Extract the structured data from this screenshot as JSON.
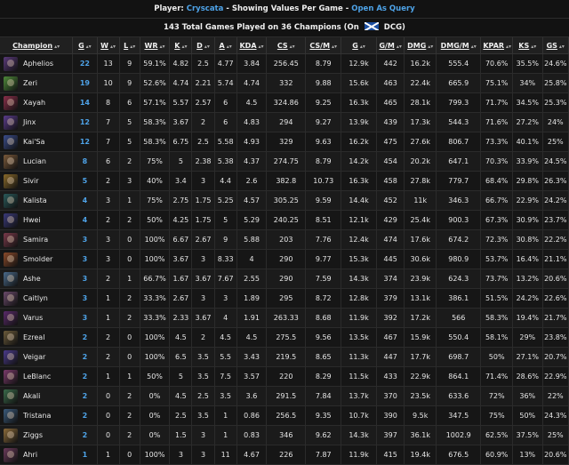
{
  "header": {
    "player_label": "Player:",
    "player_name": "Cryscata",
    "dash1": "-",
    "mode_text": "Showing Values Per Game",
    "dash2": "-",
    "query_link": "Open As Query"
  },
  "subheader": {
    "summary": "143 Total Games Played on 36 Champions (On",
    "tail": "DCG)"
  },
  "columns": [
    "Champion",
    "G",
    "W",
    "L",
    "WR",
    "K",
    "D",
    "A",
    "KDA",
    "CS",
    "CS/M",
    "G",
    "G/M",
    "DMG",
    "DMG/M",
    "KPAR",
    "KS",
    "GS"
  ],
  "rows": [
    {
      "name": "Aphelios",
      "color": "#5a3a7a",
      "cells": [
        "22",
        "13",
        "9",
        "59.1%",
        "4.82",
        "2.5",
        "4.77",
        "3.84",
        "256.45",
        "8.79",
        "12.9k",
        "442",
        "16.2k",
        "555.4",
        "70.6%",
        "35.5%",
        "24.6%"
      ]
    },
    {
      "name": "Zeri",
      "color": "#4f8a3a",
      "cells": [
        "19",
        "10",
        "9",
        "52.6%",
        "4.74",
        "2.21",
        "5.74",
        "4.74",
        "332",
        "9.88",
        "15.6k",
        "463",
        "22.4k",
        "665.9",
        "75.1%",
        "34%",
        "25.8%"
      ]
    },
    {
      "name": "Xayah",
      "color": "#8a2f4a",
      "cells": [
        "14",
        "8",
        "6",
        "57.1%",
        "5.57",
        "2.57",
        "6",
        "4.5",
        "324.86",
        "9.25",
        "16.3k",
        "465",
        "28.1k",
        "799.3",
        "71.7%",
        "34.5%",
        "25.3%"
      ]
    },
    {
      "name": "Jinx",
      "color": "#5a3c8c",
      "cells": [
        "12",
        "7",
        "5",
        "58.3%",
        "3.67",
        "2",
        "6",
        "4.83",
        "294",
        "9.27",
        "13.9k",
        "439",
        "17.3k",
        "544.3",
        "71.6%",
        "27.2%",
        "24%"
      ]
    },
    {
      "name": "Kai'Sa",
      "color": "#3a4c8a",
      "cells": [
        "12",
        "7",
        "5",
        "58.3%",
        "6.75",
        "2.5",
        "5.58",
        "4.93",
        "329",
        "9.63",
        "16.2k",
        "475",
        "27.6k",
        "806.7",
        "73.3%",
        "40.1%",
        "25%"
      ]
    },
    {
      "name": "Lucian",
      "color": "#7a5a3a",
      "cells": [
        "8",
        "6",
        "2",
        "75%",
        "5",
        "2.38",
        "5.38",
        "4.37",
        "274.75",
        "8.79",
        "14.2k",
        "454",
        "20.2k",
        "647.1",
        "70.3%",
        "33.9%",
        "24.5%"
      ]
    },
    {
      "name": "Sivir",
      "color": "#8a6a2a",
      "cells": [
        "5",
        "2",
        "3",
        "40%",
        "3.4",
        "3",
        "4.4",
        "2.6",
        "382.8",
        "10.73",
        "16.3k",
        "458",
        "27.8k",
        "779.7",
        "68.4%",
        "29.8%",
        "26.3%"
      ]
    },
    {
      "name": "Kalista",
      "color": "#2a5a5a",
      "cells": [
        "4",
        "3",
        "1",
        "75%",
        "2.75",
        "1.75",
        "5.25",
        "4.57",
        "305.25",
        "9.59",
        "14.4k",
        "452",
        "11k",
        "346.3",
        "66.7%",
        "22.9%",
        "24.2%"
      ]
    },
    {
      "name": "Hwei",
      "color": "#3a3a7a",
      "cells": [
        "4",
        "2",
        "2",
        "50%",
        "4.25",
        "1.75",
        "5",
        "5.29",
        "240.25",
        "8.51",
        "12.1k",
        "429",
        "25.4k",
        "900.3",
        "67.3%",
        "30.9%",
        "23.7%"
      ]
    },
    {
      "name": "Samira",
      "color": "#7a3a4a",
      "cells": [
        "3",
        "3",
        "0",
        "100%",
        "6.67",
        "2.67",
        "9",
        "5.88",
        "203",
        "7.76",
        "12.4k",
        "474",
        "17.6k",
        "674.2",
        "72.3%",
        "30.8%",
        "22.2%"
      ]
    },
    {
      "name": "Smolder",
      "color": "#8a4a2a",
      "cells": [
        "3",
        "3",
        "0",
        "100%",
        "3.67",
        "3",
        "8.33",
        "4",
        "290",
        "9.77",
        "15.3k",
        "445",
        "30.6k",
        "980.9",
        "53.7%",
        "16.4%",
        "21.1%"
      ]
    },
    {
      "name": "Ashe",
      "color": "#4a6a8a",
      "cells": [
        "3",
        "2",
        "1",
        "66.7%",
        "1.67",
        "3.67",
        "7.67",
        "2.55",
        "290",
        "7.59",
        "14.3k",
        "374",
        "23.9k",
        "624.3",
        "73.7%",
        "13.2%",
        "20.6%"
      ]
    },
    {
      "name": "Caitlyn",
      "color": "#6a4a6a",
      "cells": [
        "3",
        "1",
        "2",
        "33.3%",
        "2.67",
        "3",
        "3",
        "1.89",
        "295",
        "8.72",
        "12.8k",
        "379",
        "13.1k",
        "386.1",
        "51.5%",
        "24.2%",
        "22.6%"
      ]
    },
    {
      "name": "Varus",
      "color": "#5a2a6a",
      "cells": [
        "3",
        "1",
        "2",
        "33.3%",
        "2.33",
        "3.67",
        "4",
        "1.91",
        "263.33",
        "8.68",
        "11.9k",
        "392",
        "17.2k",
        "566",
        "58.3%",
        "19.4%",
        "21.7%"
      ]
    },
    {
      "name": "Ezreal",
      "color": "#6a5a3a",
      "cells": [
        "2",
        "2",
        "0",
        "100%",
        "4.5",
        "2",
        "4.5",
        "4.5",
        "275.5",
        "9.56",
        "13.5k",
        "467",
        "15.9k",
        "550.4",
        "58.1%",
        "29%",
        "23.8%"
      ]
    },
    {
      "name": "Veigar",
      "color": "#4a3a8a",
      "cells": [
        "2",
        "2",
        "0",
        "100%",
        "6.5",
        "3.5",
        "5.5",
        "3.43",
        "219.5",
        "8.65",
        "11.3k",
        "447",
        "17.7k",
        "698.7",
        "50%",
        "27.1%",
        "20.7%"
      ]
    },
    {
      "name": "LeBlanc",
      "color": "#7a3a6a",
      "cells": [
        "2",
        "1",
        "1",
        "50%",
        "5",
        "3.5",
        "7.5",
        "3.57",
        "220",
        "8.29",
        "11.5k",
        "433",
        "22.9k",
        "864.1",
        "71.4%",
        "28.6%",
        "22.9%"
      ]
    },
    {
      "name": "Akali",
      "color": "#3a6a4a",
      "cells": [
        "2",
        "0",
        "2",
        "0%",
        "4.5",
        "2.5",
        "3.5",
        "3.6",
        "291.5",
        "7.84",
        "13.7k",
        "370",
        "23.5k",
        "633.6",
        "72%",
        "36%",
        "22%"
      ]
    },
    {
      "name": "Tristana",
      "color": "#3a5a7a",
      "cells": [
        "2",
        "0",
        "2",
        "0%",
        "2.5",
        "3.5",
        "1",
        "0.86",
        "256.5",
        "9.35",
        "10.7k",
        "390",
        "9.5k",
        "347.5",
        "75%",
        "50%",
        "24.3%"
      ]
    },
    {
      "name": "Ziggs",
      "color": "#8a6a3a",
      "cells": [
        "2",
        "0",
        "2",
        "0%",
        "1.5",
        "3",
        "1",
        "0.83",
        "346",
        "9.62",
        "14.3k",
        "397",
        "36.1k",
        "1002.9",
        "62.5%",
        "37.5%",
        "25%"
      ]
    },
    {
      "name": "Ahri",
      "color": "#6a3a5a",
      "cells": [
        "1",
        "1",
        "0",
        "100%",
        "3",
        "3",
        "11",
        "4.67",
        "226",
        "7.87",
        "11.9k",
        "415",
        "19.4k",
        "676.5",
        "60.9%",
        "13%",
        "20.6%"
      ]
    }
  ]
}
